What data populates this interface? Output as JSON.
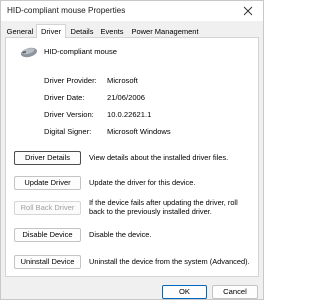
{
  "window": {
    "title": "HID-compliant mouse Properties",
    "close_glyph": "×"
  },
  "tabs": [
    {
      "label": "General",
      "active": false
    },
    {
      "label": "Driver",
      "active": true
    },
    {
      "label": "Details",
      "active": false
    },
    {
      "label": "Events",
      "active": false
    },
    {
      "label": "Power Management",
      "active": false
    }
  ],
  "device": {
    "name": "HID-compliant mouse",
    "icon": "mouse-icon"
  },
  "driver_info": [
    {
      "label": "Driver Provider:",
      "value": "Microsoft"
    },
    {
      "label": "Driver Date:",
      "value": "21/06/2006"
    },
    {
      "label": "Driver Version:",
      "value": "10.0.22621.1"
    },
    {
      "label": "Digital Signer:",
      "value": "Microsoft Windows"
    }
  ],
  "actions": [
    {
      "label": "Driver Details",
      "description": "View details about the installed driver files.",
      "enabled": true,
      "focused": true
    },
    {
      "label": "Update Driver",
      "description": "Update the driver for this device.",
      "enabled": true,
      "focused": false
    },
    {
      "label": "Roll Back Driver",
      "description": "If the device fails after updating the driver, roll back to the previously installed driver.",
      "enabled": false,
      "focused": false
    },
    {
      "label": "Disable Device",
      "description": "Disable the device.",
      "enabled": true,
      "focused": false
    },
    {
      "label": "Uninstall Device",
      "description": "Uninstall the device from the system (Advanced).",
      "enabled": true,
      "focused": false
    }
  ],
  "footer": {
    "ok_label": "OK",
    "cancel_label": "Cancel"
  },
  "colors": {
    "accent": "#0067c0",
    "disabled_text": "#a0a0a0",
    "dialog_background": "#f0f0f0"
  }
}
